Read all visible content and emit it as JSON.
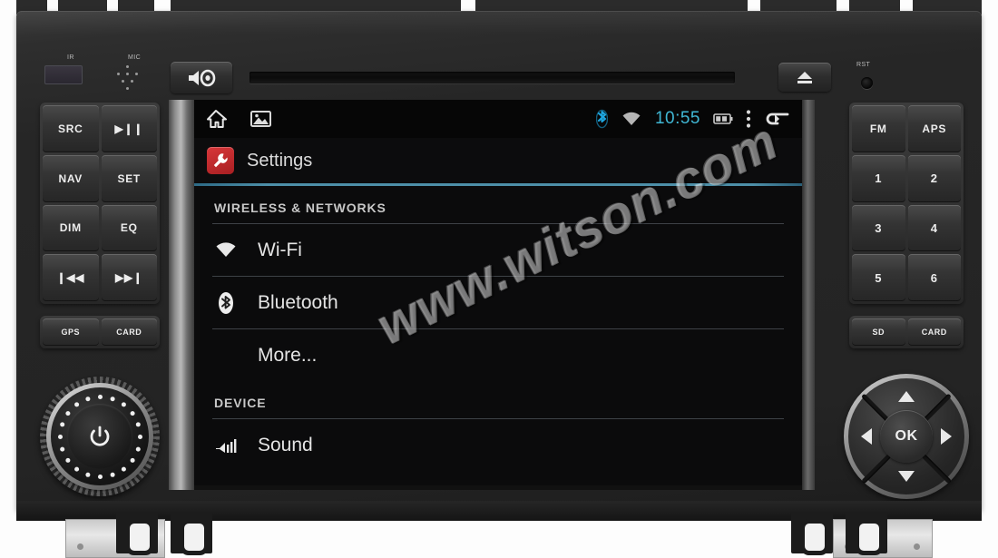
{
  "device": {
    "labels": {
      "ir": "IR",
      "mic": "MIC",
      "rst": "RST"
    },
    "top_controls": [
      {
        "name": "mute-button",
        "icon": "speaker-mute-icon"
      },
      {
        "name": "cd-slot",
        "icon": "disc-slot"
      },
      {
        "name": "eject-button",
        "icon": "eject-icon"
      },
      {
        "name": "reset-pinhole",
        "icon": "reset-icon"
      }
    ],
    "left_buttons": [
      "SRC",
      "▶❙❙",
      "NAV",
      "SET",
      "DIM",
      "EQ",
      "❙◀◀",
      "▶▶❙"
    ],
    "left_bottom_buttons": [
      "GPS",
      "CARD"
    ],
    "right_buttons": [
      "FM",
      "APS",
      "1",
      "2",
      "3",
      "4",
      "5",
      "6"
    ],
    "right_bottom_buttons": [
      "SD",
      "CARD"
    ],
    "knob": {
      "label": "power-volume-knob",
      "icon": "power-icon"
    },
    "dpad": {
      "ok_label": "OK",
      "up": "▲",
      "down": "▼",
      "left": "◀",
      "right": "▶"
    }
  },
  "screen": {
    "statusbar": {
      "left_icons": [
        {
          "name": "home-icon",
          "label": "Home"
        },
        {
          "name": "gallery-icon",
          "label": "Gallery"
        }
      ],
      "bluetooth_icon": "bluetooth-icon",
      "wifi_icon": "wifi-icon",
      "time": "10:55",
      "battery_icon": "battery-icon",
      "overflow_icon": "overflow-menu-icon",
      "back_icon": "back-icon",
      "accent_color": "#40b7d4"
    },
    "app": {
      "title": "Settings",
      "icon": "settings-wrench-icon",
      "icon_color": "#c42a2d",
      "underline_color": "#4d8fa8"
    },
    "sections": [
      {
        "label": "WIRELESS & NETWORKS",
        "rows": [
          {
            "label": "Wi-Fi",
            "icon": "wifi-icon"
          },
          {
            "label": "Bluetooth",
            "icon": "bluetooth-icon"
          },
          {
            "label": "More...",
            "icon": "none"
          }
        ]
      },
      {
        "label": "DEVICE",
        "rows": [
          {
            "label": "Sound",
            "icon": "volume-icon"
          }
        ]
      }
    ]
  },
  "watermark": {
    "text": "www.witson.com"
  }
}
